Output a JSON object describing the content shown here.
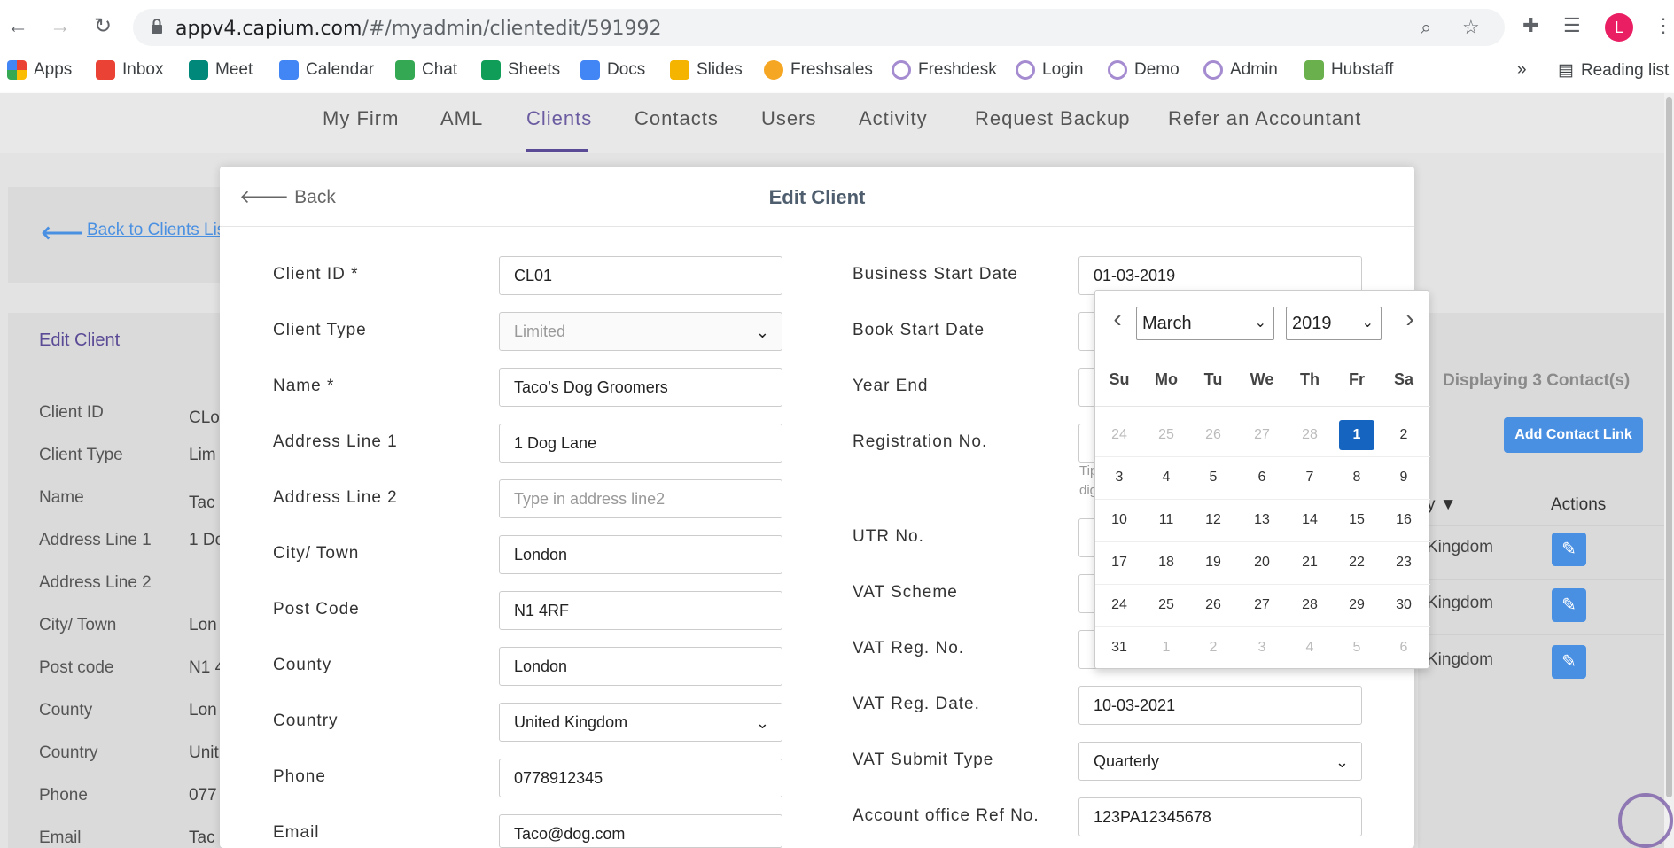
{
  "browser": {
    "url_host": "appv4.capium.com",
    "url_path": "/#/myadmin/clientedit/591992",
    "avatar_letter": "L",
    "bookmarks": [
      "Apps",
      "Inbox",
      "Meet",
      "Calendar",
      "Chat",
      "Sheets",
      "Docs",
      "Slides",
      "Freshsales",
      "Freshdesk",
      "Login",
      "Demo",
      "Admin",
      "Hubstaff"
    ],
    "more_label": "»",
    "reading_list": "Reading list"
  },
  "appnav": {
    "items": [
      "My Firm",
      "AML",
      "Clients",
      "Contacts",
      "Users",
      "Activity",
      "Request Backup",
      "Refer an Accountant"
    ],
    "active": "Clients"
  },
  "background": {
    "back_to_list": "Back to Clients List",
    "edit_title": "Edit Client",
    "labels": [
      "Client ID",
      "Client Type",
      "Name",
      "Address Line 1",
      "Address Line 2",
      "City/ Town",
      "Post code",
      "County",
      "Country",
      "Phone",
      "Email"
    ],
    "values": [
      "CLo",
      "Lim",
      "Tac",
      "1 Do",
      "",
      "Lon",
      "N1 4",
      "Lon",
      "Unit",
      "077",
      "Tac"
    ],
    "displaying": "Displaying 3 Contact(s)",
    "add_contact": "Add Contact Link",
    "col_sort": "y ▼",
    "col_actions": "Actions",
    "country_cells": [
      "Kingdom",
      "Kingdom",
      "Kingdom"
    ],
    "tip_text": "Tip",
    "tip_text2": "dig"
  },
  "modal": {
    "back": "Back",
    "title": "Edit Client",
    "left_fields": [
      {
        "label": "Client ID *",
        "value": "CL01"
      },
      {
        "label": "Client Type",
        "value": "Limited"
      },
      {
        "label": "Name *",
        "value": "Taco’s Dog Groomers"
      },
      {
        "label": "Address Line 1",
        "value": "1 Dog Lane"
      },
      {
        "label": "Address Line 2",
        "placeholder": "Type in address line2"
      },
      {
        "label": "City/ Town",
        "value": "London"
      },
      {
        "label": "Post Code",
        "value": "N1 4RF"
      },
      {
        "label": "County",
        "value": "London"
      },
      {
        "label": "Country",
        "value": "United Kingdom"
      },
      {
        "label": "Phone",
        "value": "0778912345"
      },
      {
        "label": "Email",
        "value": "Taco@dog.com"
      }
    ],
    "right_fields": [
      {
        "label": "Business Start Date",
        "value": "01-03-2019"
      },
      {
        "label": "Book Start Date",
        "value": ""
      },
      {
        "label": "Year End",
        "value": ""
      },
      {
        "label": "Registration No.",
        "value": ""
      },
      {
        "label": "UTR No.",
        "value": ""
      },
      {
        "label": "VAT Scheme",
        "value": ""
      },
      {
        "label": "VAT Reg. No.",
        "value": ""
      },
      {
        "label": "VAT Reg. Date.",
        "value": "10-03-2021"
      },
      {
        "label": "VAT Submit Type",
        "value": "Quarterly"
      },
      {
        "label": "Account office Ref No.",
        "value": "123PA12345678"
      }
    ]
  },
  "datepicker": {
    "month": "March",
    "year": "2019",
    "weekdays": [
      "Su",
      "Mo",
      "Tu",
      "We",
      "Th",
      "Fr",
      "Sa"
    ],
    "weeks": [
      [
        "24",
        "25",
        "26",
        "27",
        "28",
        "1",
        "2"
      ],
      [
        "3",
        "4",
        "5",
        "6",
        "7",
        "8",
        "9"
      ],
      [
        "10",
        "11",
        "12",
        "13",
        "14",
        "15",
        "16"
      ],
      [
        "17",
        "18",
        "19",
        "20",
        "21",
        "22",
        "23"
      ],
      [
        "24",
        "25",
        "26",
        "27",
        "28",
        "29",
        "30"
      ],
      [
        "31",
        "1",
        "2",
        "3",
        "4",
        "5",
        "6"
      ]
    ],
    "selected": "1"
  },
  "colors": {
    "accent": "#5b4a96",
    "primary_button": "#4a90e2",
    "selected_day": "#1565c0"
  }
}
